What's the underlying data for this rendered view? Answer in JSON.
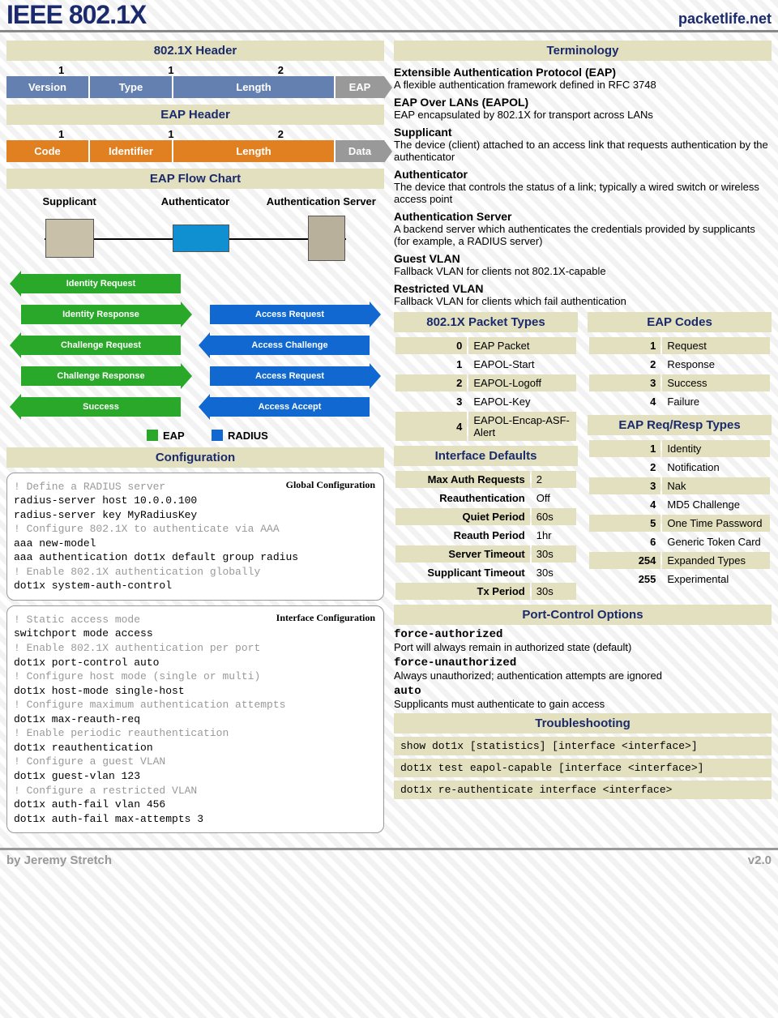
{
  "header": {
    "title": "IEEE 802.1X",
    "site": "packetlife.net"
  },
  "sections": {
    "h8021x": "802.1X  Header",
    "heap": "EAP  Header",
    "flow": "EAP Flow Chart",
    "config": "Configuration",
    "term": "Terminology",
    "packet": "802.1X Packet Types",
    "eapc": "EAP Codes",
    "reqresp": "EAP Req/Resp Types",
    "idef": "Interface Defaults",
    "pcopt": "Port-Control Options",
    "trouble": "Troubleshooting"
  },
  "h8021x": {
    "bytes": [
      "1",
      "1",
      "2"
    ],
    "fields": [
      "Version",
      "Type",
      "Length",
      "EAP"
    ]
  },
  "heap": {
    "bytes": [
      "1",
      "1",
      "2"
    ],
    "fields": [
      "Code",
      "Identifier",
      "Length",
      "Data"
    ]
  },
  "flow": {
    "labels": [
      "Supplicant",
      "Authenticator",
      "Authentication Server"
    ],
    "rows": [
      {
        "l": {
          "text": "Identity Request",
          "dir": "left",
          "color": "green"
        },
        "r": null
      },
      {
        "l": {
          "text": "Identity Response",
          "dir": "right",
          "color": "green"
        },
        "r": {
          "text": "Access Request",
          "dir": "right",
          "color": "blue"
        }
      },
      {
        "l": {
          "text": "Challenge Request",
          "dir": "left",
          "color": "green"
        },
        "r": {
          "text": "Access Challenge",
          "dir": "left",
          "color": "blue"
        }
      },
      {
        "l": {
          "text": "Challenge Response",
          "dir": "right",
          "color": "green"
        },
        "r": {
          "text": "Access Request",
          "dir": "right",
          "color": "blue"
        }
      },
      {
        "l": {
          "text": "Success",
          "dir": "left",
          "color": "green"
        },
        "r": {
          "text": "Access Accept",
          "dir": "left",
          "color": "blue"
        }
      }
    ],
    "legend": {
      "eap": "EAP",
      "radius": "RADIUS"
    }
  },
  "config": {
    "global": {
      "label": "Global Configuration",
      "lines": [
        {
          "c": true,
          "t": "! Define a RADIUS server"
        },
        {
          "c": false,
          "t": "radius-server host 10.0.0.100"
        },
        {
          "c": false,
          "t": "radius-server key MyRadiusKey"
        },
        {
          "c": true,
          "t": "! Configure 802.1X to authenticate via AAA"
        },
        {
          "c": false,
          "t": "aaa new-model"
        },
        {
          "c": false,
          "t": "aaa authentication dot1x default group radius"
        },
        {
          "c": true,
          "t": "! Enable 802.1X authentication globally"
        },
        {
          "c": false,
          "t": "dot1x system-auth-control"
        }
      ]
    },
    "iface": {
      "label": "Interface Configuration",
      "lines": [
        {
          "c": true,
          "t": "! Static access mode"
        },
        {
          "c": false,
          "t": "switchport mode access"
        },
        {
          "c": true,
          "t": "! Enable 802.1X authentication per port"
        },
        {
          "c": false,
          "t": "dot1x port-control auto"
        },
        {
          "c": true,
          "t": "! Configure host mode (single or multi)"
        },
        {
          "c": false,
          "t": "dot1x host-mode single-host"
        },
        {
          "c": true,
          "t": "! Configure maximum authentication attempts"
        },
        {
          "c": false,
          "t": "dot1x max-reauth-req"
        },
        {
          "c": true,
          "t": "! Enable periodic reauthentication"
        },
        {
          "c": false,
          "t": "dot1x reauthentication"
        },
        {
          "c": true,
          "t": "! Configure a guest VLAN"
        },
        {
          "c": false,
          "t": "dot1x guest-vlan 123"
        },
        {
          "c": true,
          "t": "! Configure a restricted VLAN"
        },
        {
          "c": false,
          "t": "dot1x auth-fail vlan 456"
        },
        {
          "c": false,
          "t": "dot1x auth-fail max-attempts 3"
        }
      ]
    }
  },
  "term": [
    {
      "t": "Extensible Authentication Protocol (EAP)",
      "d": "A flexible authentication framework defined in RFC 3748"
    },
    {
      "t": "EAP Over LANs (EAPOL)",
      "d": "EAP encapsulated by 802.1X for transport across LANs"
    },
    {
      "t": "Supplicant",
      "d": "The device (client) attached to an access link that requests authentication by the authenticator"
    },
    {
      "t": "Authenticator",
      "d": "The device that controls the status of a link; typically a wired switch or wireless access point"
    },
    {
      "t": "Authentication Server",
      "d": "A backend server which authenticates the credentials provided by supplicants (for example, a RADIUS server)"
    },
    {
      "t": "Guest VLAN",
      "d": "Fallback VLAN for clients not 802.1X-capable"
    },
    {
      "t": "Restricted VLAN",
      "d": "Fallback VLAN for clients which fail authentication"
    }
  ],
  "packet": [
    [
      "0",
      "EAP Packet"
    ],
    [
      "1",
      "EAPOL-Start"
    ],
    [
      "2",
      "EAPOL-Logoff"
    ],
    [
      "3",
      "EAPOL-Key"
    ],
    [
      "4",
      "EAPOL-Encap-ASF-Alert"
    ]
  ],
  "eapc": [
    [
      "1",
      "Request"
    ],
    [
      "2",
      "Response"
    ],
    [
      "3",
      "Success"
    ],
    [
      "4",
      "Failure"
    ]
  ],
  "reqresp": [
    [
      "1",
      "Identity"
    ],
    [
      "2",
      "Notification"
    ],
    [
      "3",
      "Nak"
    ],
    [
      "4",
      "MD5 Challenge"
    ],
    [
      "5",
      "One Time Password"
    ],
    [
      "6",
      "Generic Token Card"
    ],
    [
      "254",
      "Expanded Types"
    ],
    [
      "255",
      "Experimental"
    ]
  ],
  "idef": [
    [
      "Max Auth Requests",
      "2"
    ],
    [
      "Reauthentication",
      "Off"
    ],
    [
      "Quiet Period",
      "60s"
    ],
    [
      "Reauth Period",
      "1hr"
    ],
    [
      "Server Timeout",
      "30s"
    ],
    [
      "Supplicant Timeout",
      "30s"
    ],
    [
      "Tx Period",
      "30s"
    ]
  ],
  "pcopt": [
    {
      "t": "force-authorized",
      "d": "Port will always remain in authorized state (default)"
    },
    {
      "t": "force-unauthorized",
      "d": "Always unauthorized; authentication attempts are ignored"
    },
    {
      "t": "auto",
      "d": "Supplicants must authenticate to gain access"
    }
  ],
  "trouble": [
    "show dot1x [statistics] [interface <interface>]",
    "dot1x test eapol-capable [interface <interface>]",
    "dot1x re-authenticate interface <interface>"
  ],
  "footer": {
    "by": "by Jeremy Stretch",
    "v": "v2.0"
  }
}
